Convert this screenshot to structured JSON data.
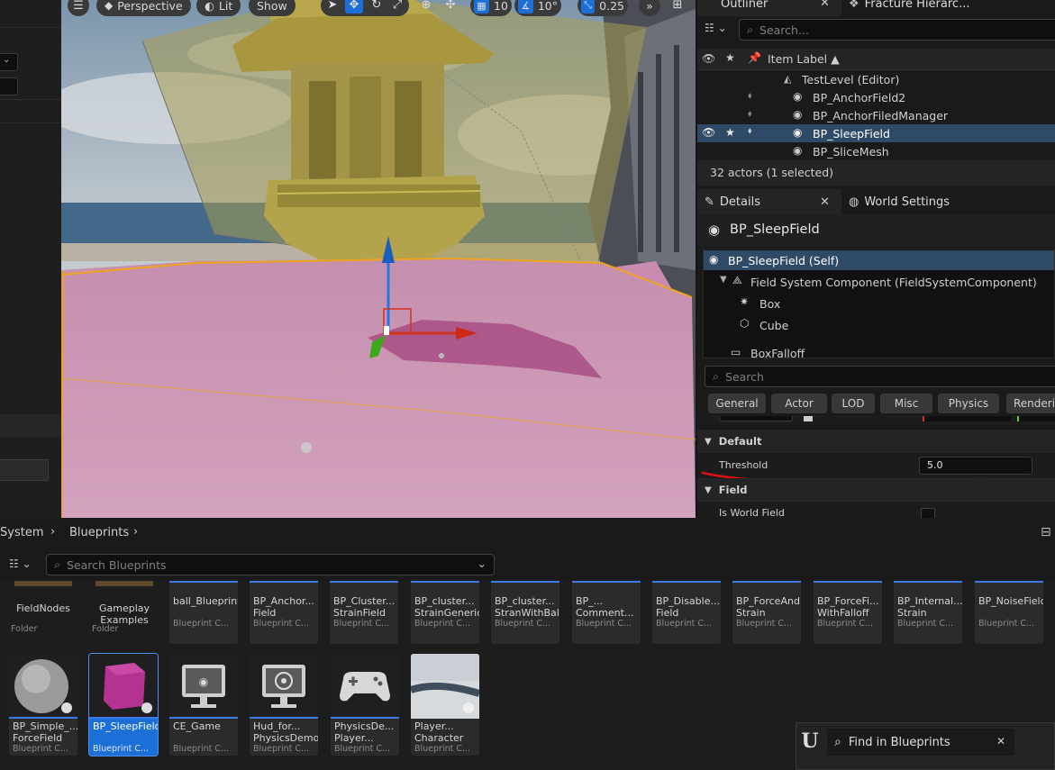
{
  "viewport": {
    "perspective_label": "Perspective",
    "lit_label": "Lit",
    "show_label": "Show",
    "grid_snap_value": "10",
    "rotation_snap_value": "10°",
    "scale_snap_value": "0.25"
  },
  "outliner": {
    "tab_label": "Outliner",
    "second_tab_label": "Fracture Hierarc...",
    "search_placeholder": "Search...",
    "column_item_label": "Item Label ▲",
    "rows": [
      {
        "label": "TestLevel (Editor)"
      },
      {
        "label": "BP_AnchorField2"
      },
      {
        "label": "BP_AnchorFiledManager"
      },
      {
        "label": "BP_SleepField"
      },
      {
        "label": "BP_SliceMesh"
      }
    ],
    "status": "32 actors (1 selected)"
  },
  "details": {
    "tab_label": "Details",
    "world_settings_label": "World Settings",
    "actor_name": "BP_SleepField",
    "components": [
      {
        "label": "BP_SleepField (Self)"
      },
      {
        "label": "Field System Component (FieldSystemComponent)"
      },
      {
        "label": "Box"
      },
      {
        "label": "Cube"
      },
      {
        "label": "BoxFalloff"
      }
    ],
    "search_placeholder": "Search",
    "filters": [
      "General",
      "Actor",
      "LOD",
      "Misc",
      "Physics",
      "Renderin"
    ],
    "sections": {
      "default_label": "Default",
      "field_label": "Field"
    },
    "threshold_label": "Threshold",
    "threshold_value": "5.0",
    "is_world_field_label": "Is World Field"
  },
  "content_browser": {
    "breadcrumb": [
      "System",
      "Blueprints"
    ],
    "search_placeholder": "Search Blueprints",
    "top_row": [
      {
        "name": "FieldNodes",
        "type": "Folder"
      },
      {
        "name": "Gameplay\nExamples",
        "type": "Folder"
      },
      {
        "name": "ball_Blueprint",
        "type": "Blueprint C..."
      },
      {
        "name": "BP_Anchor...\nField",
        "type": "Blueprint C..."
      },
      {
        "name": "BP_Cluster...\nStrainField",
        "type": "Blueprint C..."
      },
      {
        "name": "BP_cluster...\nStrainGeneric",
        "type": "Blueprint C..."
      },
      {
        "name": "BP_cluster...\nStranWithBall",
        "type": "Blueprint C..."
      },
      {
        "name": "BP_...\nComment...",
        "type": "Blueprint C..."
      },
      {
        "name": "BP_Disable...\nField",
        "type": "Blueprint C..."
      },
      {
        "name": "BP_ForceAnd...\nStrain",
        "type": "Blueprint C..."
      },
      {
        "name": "BP_ForceFi...\nWithFalloff",
        "type": "Blueprint C..."
      },
      {
        "name": "BP_Internal...\nStrain",
        "type": "Blueprint C..."
      },
      {
        "name": "BP_NoiseField",
        "type": "Blueprint C..."
      }
    ],
    "bottom_row": [
      {
        "name": "BP_Simple_...\nForceField",
        "type": "Blueprint C..."
      },
      {
        "name": "BP_SleepField",
        "type": "Blueprint C..."
      },
      {
        "name": "CE_Game",
        "type": "Blueprint C..."
      },
      {
        "name": "Hud_for...\nPhysicsDemo",
        "type": "Blueprint C..."
      },
      {
        "name": "PhysicsDe...\nPlayer...",
        "type": "Blueprint C..."
      },
      {
        "name": "Player...\nCharacter",
        "type": "Blueprint C..."
      }
    ]
  },
  "find_panel": {
    "title": "Find in Blueprints"
  },
  "colors": {
    "selection": "#2f4a66",
    "accent_blue": "#1d6fd8",
    "annotation_red": "#e01010"
  }
}
